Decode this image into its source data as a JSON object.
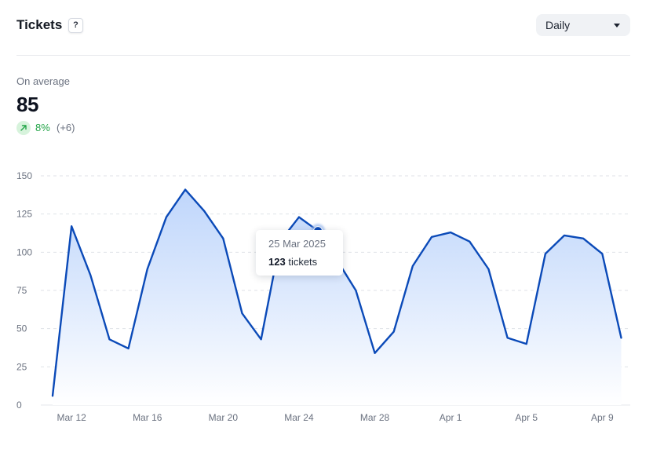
{
  "header": {
    "title": "Tickets",
    "help_label": "?",
    "period_select": {
      "value": "Daily"
    }
  },
  "summary": {
    "label": "On average",
    "value": "85",
    "trend_percent": "8%",
    "trend_delta": "(+6)",
    "trend_color": "#22a447"
  },
  "tooltip": {
    "date": "25 Mar 2025",
    "count": "123",
    "unit": "tickets"
  },
  "chart_data": {
    "type": "area",
    "x": [
      "2025-03-11",
      "2025-03-12",
      "2025-03-13",
      "2025-03-14",
      "2025-03-15",
      "2025-03-16",
      "2025-03-17",
      "2025-03-18",
      "2025-03-19",
      "2025-03-20",
      "2025-03-21",
      "2025-03-22",
      "2025-03-23",
      "2025-03-24",
      "2025-03-25",
      "2025-03-26",
      "2025-03-27",
      "2025-03-28",
      "2025-03-29",
      "2025-03-30",
      "2025-03-31",
      "2025-04-01",
      "2025-04-02",
      "2025-04-03",
      "2025-04-04",
      "2025-04-05",
      "2025-04-06",
      "2025-04-07",
      "2025-04-08",
      "2025-04-09",
      "2025-04-10"
    ],
    "series": [
      {
        "values": [
          6,
          117,
          85,
          43,
          37,
          89,
          123,
          141,
          127,
          109,
          60,
          43,
          107,
          123,
          114,
          95,
          75,
          34,
          48,
          91,
          110,
          113,
          107,
          89,
          44,
          40,
          99,
          111,
          109,
          99,
          44
        ]
      }
    ],
    "x_tick_labels": [
      "Mar 12",
      "Mar 16",
      "Mar 20",
      "Mar 24",
      "Mar 28",
      "Apr 1",
      "Apr 5",
      "Apr 9"
    ],
    "x_tick_dates": [
      "2025-03-12",
      "2025-03-16",
      "2025-03-20",
      "2025-03-24",
      "2025-03-28",
      "2025-04-01",
      "2025-04-05",
      "2025-04-09"
    ],
    "y_ticks": [
      0,
      25,
      50,
      75,
      100,
      125,
      150
    ],
    "ylim": [
      0,
      150
    ],
    "grid": true,
    "highlight_date": "2025-03-25",
    "colors": {
      "line": "#0b4ab8",
      "fill_top": "#bcd4fb",
      "fill_bottom": "#ffffff",
      "grid": "#dfe2e7",
      "axis_text": "#6b7280"
    }
  }
}
